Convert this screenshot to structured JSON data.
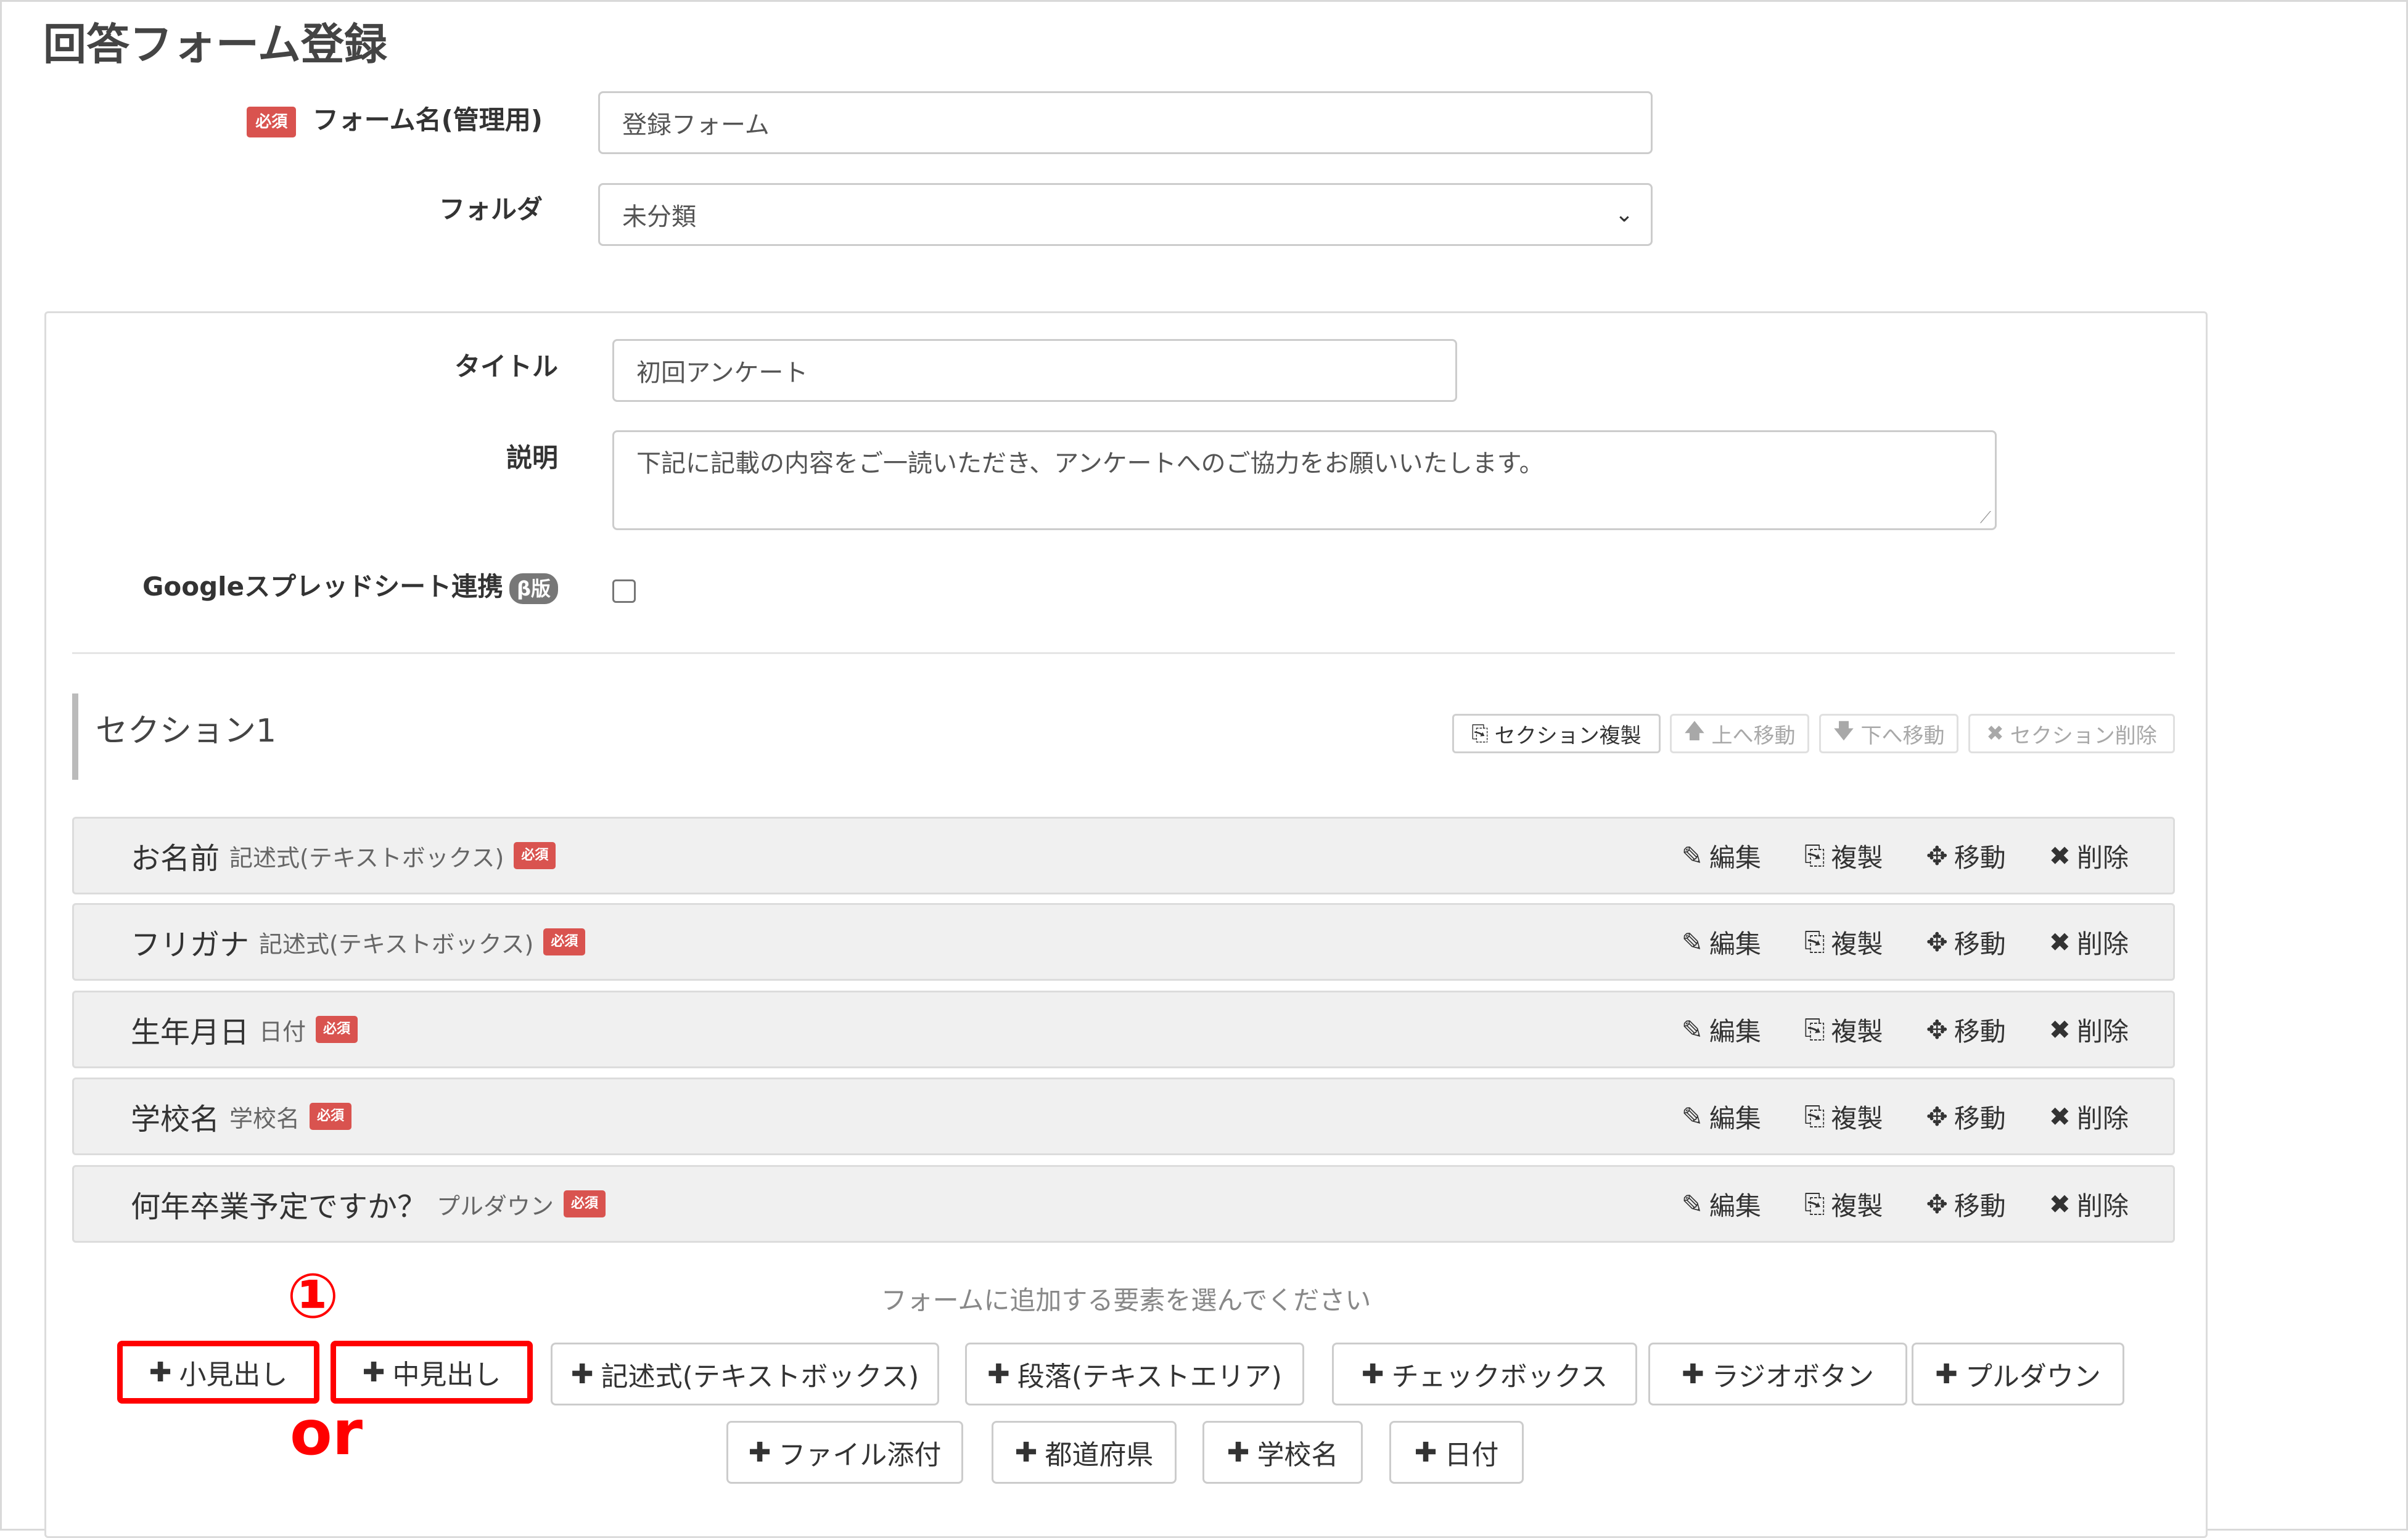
{
  "page": {
    "title": "回答フォーム登録"
  },
  "form": {
    "required_badge": "必須",
    "name_label": "フォーム名(管理用)",
    "name_value": "登録フォーム",
    "folder_label": "フォルダ",
    "folder_value": "未分類"
  },
  "panel": {
    "title_label": "タイトル",
    "title_value": "初回アンケート",
    "desc_label": "説明",
    "desc_value": "下記に記載の内容をご一読いただき、アンケートへのご協力をお願いいたします。",
    "google_label": "Googleスプレッドシート連携",
    "beta_badge": "β版",
    "google_checked": false
  },
  "section": {
    "title": "セクション1",
    "tools": [
      {
        "label": "セクション複製",
        "icon": "copy-icon",
        "glyph": "⎘",
        "disabled": false
      },
      {
        "label": "上へ移動",
        "icon": "arrow-up-icon",
        "glyph": "🡅",
        "disabled": true
      },
      {
        "label": "下へ移動",
        "icon": "arrow-down-icon",
        "glyph": "🡇",
        "disabled": true
      },
      {
        "label": "セクション削除",
        "icon": "close-icon",
        "glyph": "✖",
        "disabled": true
      }
    ]
  },
  "questions": [
    {
      "title": "お名前",
      "type": "記述式(テキストボックス)",
      "required": "必須"
    },
    {
      "title": "フリガナ",
      "type": "記述式(テキストボックス)",
      "required": "必須"
    },
    {
      "title": "生年月日",
      "type": "日付",
      "required": "必須"
    },
    {
      "title": "学校名",
      "type": "学校名",
      "required": "必須"
    },
    {
      "title": "何年卒業予定ですか？",
      "type": "プルダウン",
      "required": "必須"
    }
  ],
  "question_actions": [
    {
      "label": "編集",
      "icon": "pencil-icon",
      "glyph": "✎"
    },
    {
      "label": "複製",
      "icon": "copy-icon",
      "glyph": "⎘"
    },
    {
      "label": "移動",
      "icon": "move-icon",
      "glyph": "✥"
    },
    {
      "label": "削除",
      "icon": "close-icon",
      "glyph": "✖"
    }
  ],
  "add_elements": {
    "hint": "フォームに追加する要素を選んでください",
    "plus_glyph": "✚",
    "buttons": [
      {
        "label": "小見出し",
        "highlighted": true
      },
      {
        "label": "中見出し",
        "highlighted": true
      },
      {
        "label": "記述式(テキストボックス)",
        "highlighted": false
      },
      {
        "label": "段落(テキストエリア)",
        "highlighted": false
      },
      {
        "label": "チェックボックス",
        "highlighted": false
      },
      {
        "label": "ラジオボタン",
        "highlighted": false
      },
      {
        "label": "プルダウン",
        "highlighted": false
      },
      {
        "label": "ファイル添付",
        "highlighted": false
      },
      {
        "label": "都道府県",
        "highlighted": false
      },
      {
        "label": "学校名",
        "highlighted": false
      },
      {
        "label": "日付",
        "highlighted": false
      }
    ]
  },
  "annotations": {
    "step_number": "①",
    "or_text": "or",
    "color": "#ff0000"
  }
}
